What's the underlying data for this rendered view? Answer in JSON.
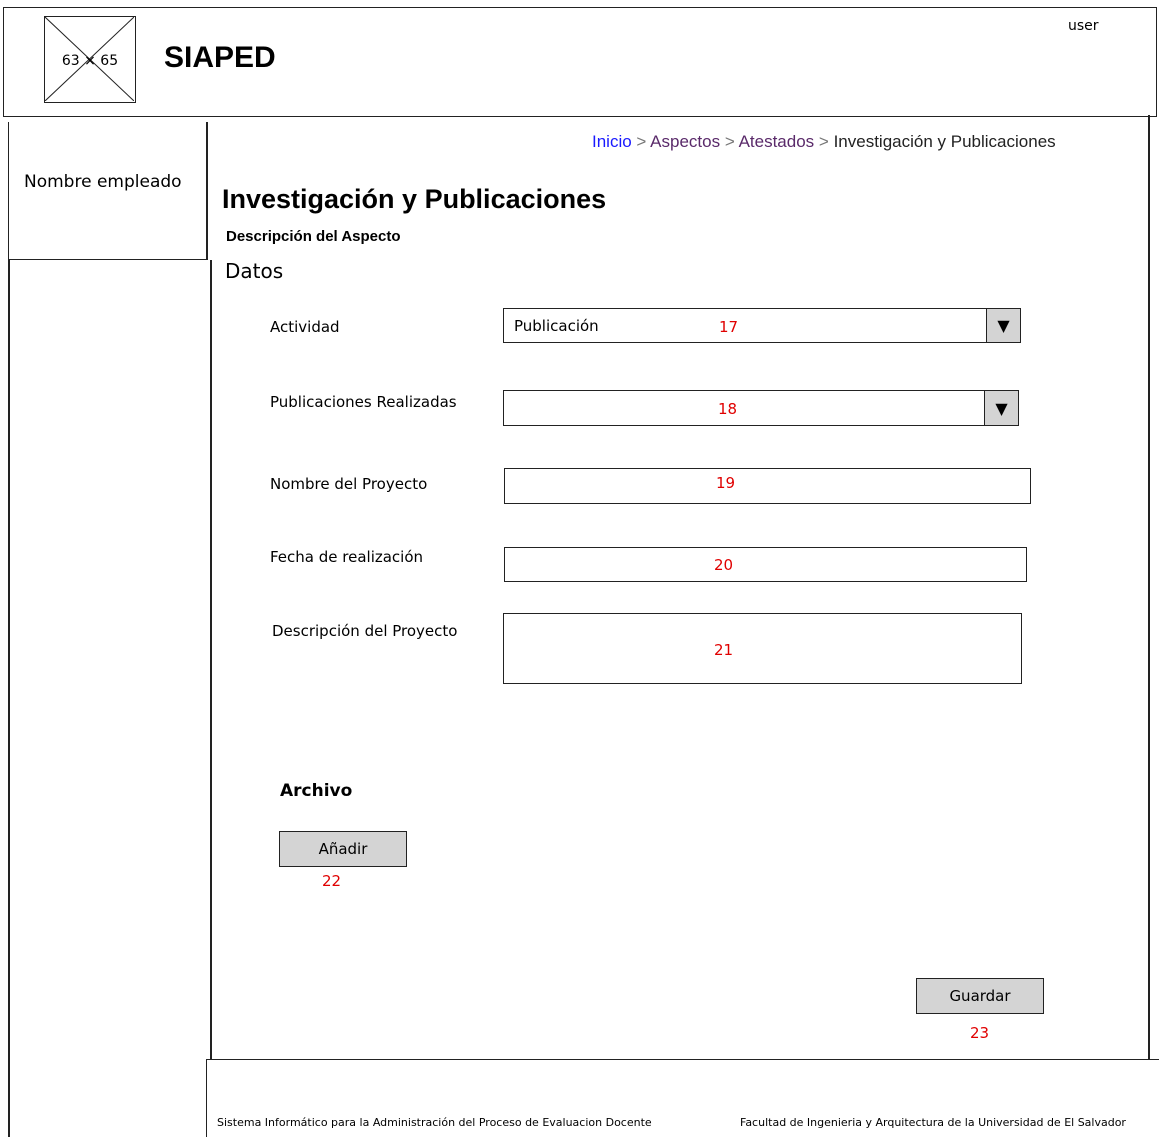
{
  "header": {
    "logo_placeholder": "63 × 65",
    "app_title": "SIAPED",
    "user": "user"
  },
  "sidebar": {
    "employee_name": "Nombre empleado"
  },
  "breadcrumb": {
    "items": [
      "Inicio",
      "Aspectos",
      "Atestados"
    ],
    "separator": ">",
    "current": "Investigación y Publicaciones"
  },
  "main": {
    "title": "Investigación y Publicaciones",
    "aspect_description": "Descripción del Aspecto",
    "section_title": "Datos",
    "fields": {
      "actividad": {
        "label": "Actividad",
        "value": "Publicación",
        "annotation": "17"
      },
      "publicaciones": {
        "label": "Publicaciones Realizadas",
        "value": "",
        "annotation": "18"
      },
      "nombre_proyecto": {
        "label": "Nombre del Proyecto",
        "value": "",
        "annotation": "19"
      },
      "fecha": {
        "label": "Fecha de realización",
        "value": "",
        "annotation": "20"
      },
      "descripcion": {
        "label": "Descripción  del Proyecto",
        "value": "",
        "annotation": "21"
      }
    },
    "archivo": {
      "title": "Archivo",
      "add_label": "Añadir",
      "annotation": "22"
    },
    "save": {
      "label": "Guardar",
      "annotation": "23"
    }
  },
  "footer": {
    "left": "Sistema Informático para la Administración del Proceso de Evaluacion Docente",
    "right": "Facultad de Ingenieria y Arquitectura de la Universidad de El Salvador"
  },
  "icons": {
    "dropdown": "triangle-down-icon",
    "logo": "image-placeholder-icon"
  }
}
